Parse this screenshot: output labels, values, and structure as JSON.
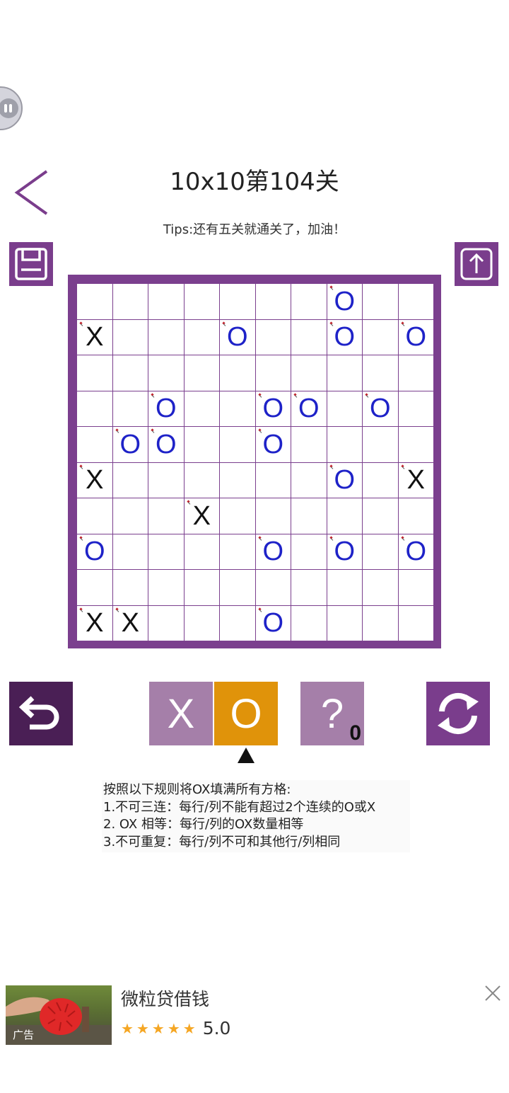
{
  "header": {
    "title": "10x10第104关",
    "tips": "Tips:还有五关就通关了，加油！"
  },
  "grid": [
    [
      "",
      "",
      "",
      "",
      "",
      "",
      "",
      "O*",
      "",
      ""
    ],
    [
      "X*",
      "",
      "",
      "",
      "O*",
      "",
      "",
      "O*",
      "",
      "O*"
    ],
    [
      "",
      "",
      "",
      "",
      "",
      "",
      "",
      "",
      "",
      ""
    ],
    [
      "",
      "",
      "O*",
      "",
      "",
      "O*",
      "O*",
      "",
      "O*",
      ""
    ],
    [
      "",
      "O*",
      "O*",
      "",
      "",
      "O*",
      "",
      "",
      "",
      ""
    ],
    [
      "X*",
      "",
      "",
      "",
      "",
      "",
      "",
      "O*",
      "",
      "X*"
    ],
    [
      "",
      "",
      "",
      "X*",
      "",
      "",
      "",
      "",
      "",
      ""
    ],
    [
      "O*",
      "",
      "",
      "",
      "",
      "O*",
      "",
      "O*",
      "",
      "O*"
    ],
    [
      "",
      "",
      "",
      "",
      "",
      "",
      "",
      "",
      "",
      ""
    ],
    [
      "X*",
      "X*",
      "",
      "",
      "",
      "O*",
      "",
      "",
      "",
      ""
    ]
  ],
  "controls": {
    "mode_x_label": "X",
    "mode_o_label": "O",
    "selected_mode": "O",
    "hint_label": "?",
    "hint_count": "0"
  },
  "rules": {
    "lines": [
      "按照以下规则将OX填满所有方格:",
      "1.不可三连：每行/列不能有超过2个连续的O或X",
      "2. OX 相等：每行/列的OX数量相等",
      "3.不可重复：每行/列不可和其他行/列相同"
    ]
  },
  "ad": {
    "tag": "广告",
    "title": "微粒贷借钱",
    "rating": "5.0",
    "stars": 5
  },
  "colors": {
    "accent": "#7b3f8e",
    "selected": "#e0930a",
    "o_mark": "#1e22c8",
    "x_mark": "#111111"
  },
  "icons": {
    "back": "chevron-left-icon",
    "save": "floppy-disk-icon",
    "share": "share-up-icon",
    "undo": "undo-arrow-icon",
    "refresh": "refresh-icon",
    "close": "close-icon"
  }
}
